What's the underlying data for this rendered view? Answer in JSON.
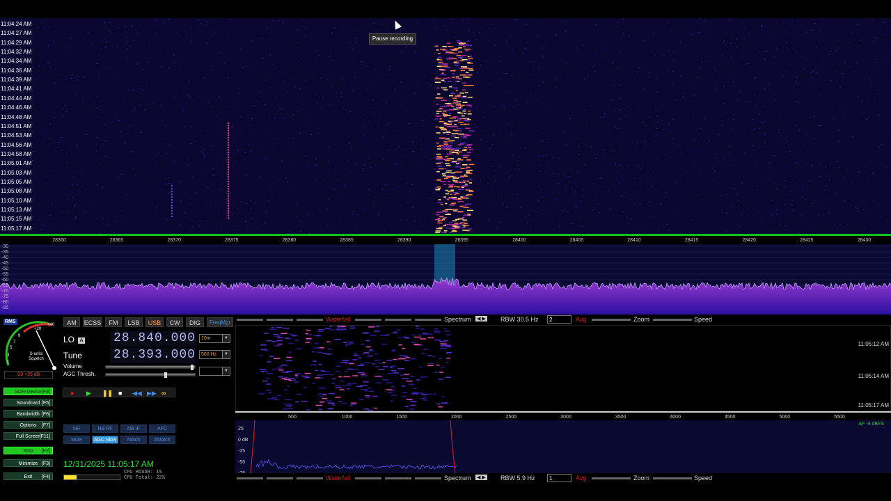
{
  "waterfall": {
    "timestamps": [
      "11:04:24 AM",
      "11:04:27 AM",
      "11:04:29 AM",
      "11:04:32 AM",
      "11:04:34 AM",
      "11:04:36 AM",
      "11:04:39 AM",
      "11:04:41 AM",
      "11:04:44 AM",
      "11:04:46 AM",
      "11:04:48 AM",
      "11:04:51 AM",
      "11:04:53 AM",
      "11:04:56 AM",
      "11:04:58 AM",
      "11:05:01 AM",
      "11:05:03 AM",
      "11:05:05 AM",
      "11:05:08 AM",
      "11:05:10 AM",
      "11:05:13 AM",
      "11:05:15 AM",
      "11:05:17 AM"
    ],
    "tooltip": "Pause recording"
  },
  "freq_scale": {
    "ticks": [
      "28360",
      "28365",
      "28370",
      "28375",
      "28380",
      "28385",
      "28390",
      "28395",
      "28400",
      "28405",
      "28410",
      "28415",
      "28420",
      "28425",
      "28430"
    ]
  },
  "spectrum": {
    "db_labels": [
      "-30",
      "-35",
      "-40",
      "-45",
      "-50",
      "-55",
      "-60",
      "-65",
      "-70",
      "-75",
      "-80",
      "-85"
    ]
  },
  "smeter": {
    "rms": "RMS",
    "reading": "S9 +25 dB",
    "caption": "S-units\nSquelch",
    "scale_labels": [
      "1",
      "3",
      "5",
      "7",
      "9",
      "+20",
      "+40"
    ]
  },
  "modes": [
    "AM",
    "ECSS",
    "FM",
    "LSB",
    "USB",
    "CW",
    "DIG",
    "FreqMgr"
  ],
  "active_mode": "USB",
  "lo": {
    "label": "LO",
    "badge": "A",
    "value": "28.840.000",
    "band": "10m"
  },
  "tune": {
    "label": "Tune",
    "value": "28.393.000",
    "bw": "500 Hz"
  },
  "sliders": {
    "volume": "Volume",
    "agc": "AGC Thresh.",
    "volume_level": 0.98,
    "agc_level": 0.6
  },
  "side_buttons": [
    {
      "label": "SDR-Device",
      "key": "[F8]",
      "green": true
    },
    {
      "label": "Soundcard",
      "key": "[F5]",
      "green": false
    },
    {
      "label": "Bandwidth",
      "key": "[F6]",
      "green": false
    },
    {
      "label": "Options",
      "key": "[F7]",
      "green": false
    },
    {
      "label": "Full Screen",
      "key": "[F11]",
      "green": false
    },
    {
      "label": "Stop",
      "key": "[F2]",
      "green": true
    },
    {
      "label": "Minimize",
      "key": "[F3]",
      "green": false
    },
    {
      "label": "Exit",
      "key": "[F4]",
      "green": false
    }
  ],
  "dsp_row1": [
    "NR",
    "NB RF",
    "NB IF",
    "AFC"
  ],
  "dsp_row2": [
    "Mute",
    "AGC Slow",
    "Notch",
    "ANotch"
  ],
  "datetime": "12/31/2025 11:05:17 AM",
  "cpu": {
    "hdsdr": "CPU HDSDR: 1%",
    "total": "CPU Total: 22%"
  },
  "level_fraction": 0.22,
  "rf_toolbar": {
    "waterfall": "Waterfall",
    "spectrum": "Spectrum",
    "rbw": "RBW 30.5 Hz",
    "avg_value": "2",
    "avg": "Avg",
    "zoom": "Zoom",
    "speed": "Speed"
  },
  "af_toolbar": {
    "waterfall": "Waterfall",
    "spectrum": "Spectrum",
    "rbw": "RBW  5.9 Hz",
    "avg_value": "1",
    "avg": "Avg",
    "zoom": "Zoom",
    "speed": "Speed"
  },
  "af_waterfall": {
    "times": [
      "11:05:12 AM",
      "11:05:14 AM",
      "11:05:17 AM"
    ]
  },
  "af_scale": {
    "ticks": [
      "500",
      "1000",
      "1500",
      "2000",
      "2500",
      "3000",
      "3500",
      "4000",
      "4500",
      "5000",
      "5500"
    ]
  },
  "af_spectrum": {
    "db_labels": [
      "25",
      "0 dB",
      "-25",
      "-50",
      "-75"
    ],
    "level": "AF -9 dBFS"
  },
  "colors": {
    "accent_green": "#1ec81e",
    "mode_active": "#ff9a2a",
    "waterfall_bg": "#0a0630"
  }
}
